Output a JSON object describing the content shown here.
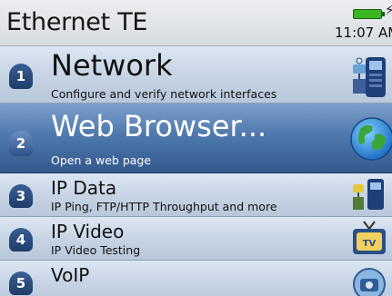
{
  "header": {
    "title": "Ethernet TE",
    "time": "11:07 AM",
    "battery_icon": "battery-icon",
    "charging_icon": "lightning-icon",
    "battery_color": "#39b620"
  },
  "menu": {
    "items": [
      {
        "number": "1",
        "title": "Network",
        "description": "Configure and verify network interfaces",
        "icon": "network-tester-icon",
        "selected": false
      },
      {
        "number": "2",
        "title": "Web Browser...",
        "description": "Open a web page",
        "icon": "globe-icon",
        "selected": true
      },
      {
        "number": "3",
        "title": "IP Data",
        "description": "IP Ping, FTP/HTTP Throughput and more",
        "icon": "ip-data-icon",
        "selected": false
      },
      {
        "number": "4",
        "title": "IP Video",
        "description": "IP Video Testing",
        "icon": "tv-icon",
        "selected": false
      },
      {
        "number": "5",
        "title": "VoIP",
        "description": "",
        "icon": "phone-icon",
        "selected": false
      }
    ]
  },
  "colors": {
    "selected_row": "#4f79ad",
    "row": "#c6d3e4",
    "number_badge": "#1e3c69"
  }
}
